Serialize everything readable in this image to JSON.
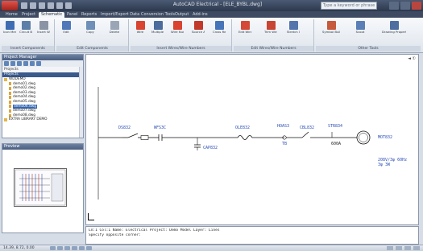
{
  "titlebar": {
    "title": "AutoCAD Electrical - [ELE_BYBL.dwg]",
    "search_placeholder": "Type a keyword or phrase",
    "accent": "#2c384d"
  },
  "tabs": [
    "Home",
    "Project",
    "Schematic",
    "Panel",
    "Reports",
    "Import/Export Data",
    "Conversion Tools",
    "Output",
    "Add-ins"
  ],
  "active_tab_index": 2,
  "ribbon": {
    "panels": [
      {
        "title": "Insert Components",
        "buttons": [
          "Icon Menu",
          "Circuit Builder",
          "Insert Wires"
        ]
      },
      {
        "title": "Edit Components",
        "buttons": [
          "Edit",
          "Copy",
          "Delete"
        ]
      },
      {
        "title": "Insert Wires/Wire Numbers",
        "buttons": [
          "Wire",
          "Multiple Bus",
          "Wire Numbers",
          "Source Arrow",
          "Cross Ref"
        ]
      },
      {
        "title": "Edit Wires/Wire Numbers",
        "buttons": [
          "Edit Wire Number",
          "Trim Wire",
          "Stretch Wire"
        ]
      },
      {
        "title": "Other Tools",
        "buttons": [
          "Symbol Builder",
          "Scoot",
          "Drawing Properties"
        ]
      }
    ]
  },
  "project_manager": {
    "title": "Project Manager",
    "current_label": "Projects",
    "section_label": "Projects",
    "tree": [
      {
        "label": "WDDEMO",
        "type": "folder",
        "selected": false
      },
      {
        "label": "demo01.dwg",
        "type": "file",
        "selected": false
      },
      {
        "label": "demo02.dwg",
        "type": "file",
        "selected": false
      },
      {
        "label": "demo03.dwg",
        "type": "file",
        "selected": false
      },
      {
        "label": "demo04.dwg",
        "type": "file",
        "selected": false
      },
      {
        "label": "demo05.dwg",
        "type": "file",
        "selected": false
      },
      {
        "label": "demo06.dwg",
        "type": "file",
        "selected": true
      },
      {
        "label": "demo07.dwg",
        "type": "file",
        "selected": false
      },
      {
        "label": "demo08.dwg",
        "type": "file",
        "selected": false
      },
      {
        "label": "EXTRA LIBRARY DEMO",
        "type": "folder",
        "selected": false
      }
    ]
  },
  "preview": {
    "title": "Preview"
  },
  "drawing": {
    "labels": {
      "ds": "DS832",
      "fuse": "WFS3C",
      "cap": "CAP832",
      "ol": "OLE832",
      "meter": "HOAS3",
      "tb": "TB",
      "sw": "CBL832",
      "ct": "STR834",
      "ct_val": "600A",
      "motor": "MOT832",
      "volt1": "208V/3φ  60Hz",
      "volt2": "3φ 3W"
    },
    "marker": "◄ ①"
  },
  "command": {
    "line1": "Ln:1 Col:1  Name: Electrical  Project: Demo  Model  Layer: Lines",
    "line2": "Specify opposite corner:"
  },
  "status": {
    "coords": "14.39, 8.72, 0.00"
  }
}
